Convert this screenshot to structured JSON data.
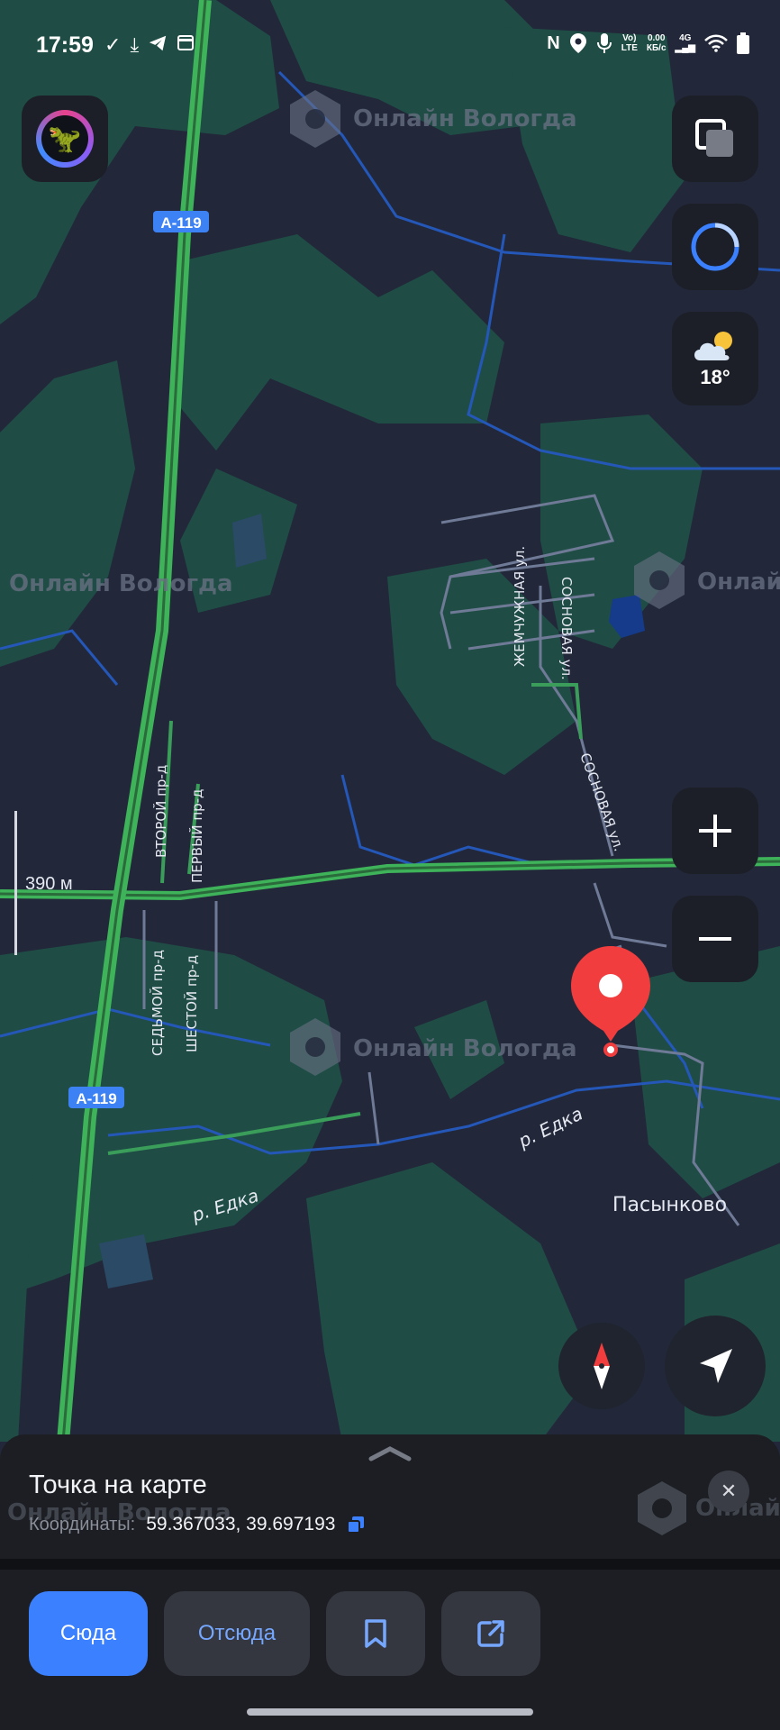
{
  "status_bar": {
    "time": "17:59",
    "left_icons": [
      "check-icon",
      "download-icon",
      "telegram-icon",
      "calendar-icon"
    ],
    "right_icons": [
      "nfc-icon",
      "location-icon",
      "mic-icon"
    ],
    "volte_top": "Vo)",
    "volte_bottom": "LTE",
    "speed_top": "0.00",
    "speed_bottom": "КБ/с",
    "network": "4G"
  },
  "map": {
    "watermark": "Онлайн Вологда",
    "roads": {
      "highway_label_1": "А-119",
      "highway_label_2": "А-119",
      "street_vtoroy": "ВТОРОЙ пр-д",
      "street_perviy": "ПЕРВЫЙ пр-д",
      "street_sedmoy": "СЕДЬМОЙ пр-д",
      "street_shestoy": "ШЕСТОЙ пр-д",
      "street_zhemchuzhnaya": "ЖЕМЧУЖНАЯ ул.",
      "street_sosnovaya_1": "СОСНОВАЯ ул.",
      "street_sosnovaya_2": "СОСНОВАЯ ул."
    },
    "river_1": "р. Едка",
    "river_2": "р. Едка",
    "village": "Пасынково",
    "scale": "390 м",
    "weather_temp": "18°",
    "colors": {
      "background": "#22283a",
      "forest": "#1f4d45",
      "highway": "#3fb35a",
      "water": "#153b8a",
      "pin": "#f13d3d"
    }
  },
  "sheet": {
    "title": "Точка на карте",
    "coords_label": "Координаты:",
    "coords_value": "59.367033, 39.697193",
    "watermark": "Онлайн Вологда",
    "watermark_right": "Онлай",
    "close_icon": "close-icon"
  },
  "actions": {
    "here": "Сюда",
    "from": "Отсюда",
    "bookmark_icon": "bookmark-icon",
    "share_icon": "share-icon"
  }
}
